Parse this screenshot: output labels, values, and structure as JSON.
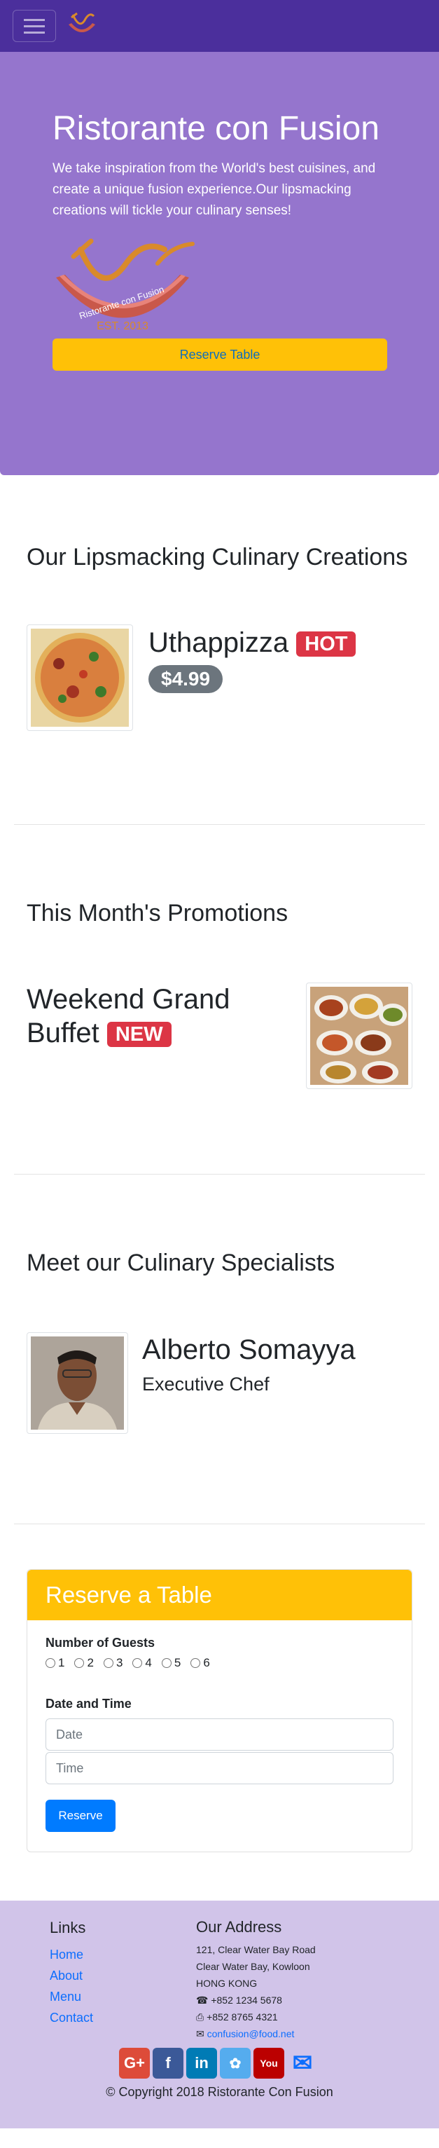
{
  "navbar": {
    "menu_icon": "hamburger-icon",
    "logo_icon": "logo-icon"
  },
  "jumbotron": {
    "title": "Ristorante con Fusion",
    "text": "We take inspiration from the World's best cuisines, and create a unique fusion experience.Our lipsmacking creations will tickle your culinary senses!",
    "logo_text": "Ristorante con Fusion",
    "logo_est": "EST. 2013",
    "reserve_button": "Reserve Table"
  },
  "dish": {
    "heading": "Our Lipsmacking Culinary Creations",
    "name": "Uthappizza",
    "badge": "HOT",
    "price": "$4.99"
  },
  "promotion": {
    "heading": "This Month's Promotions",
    "name": "Weekend Grand Buffet",
    "badge": "NEW"
  },
  "leader": {
    "heading": "Meet our Culinary Specialists",
    "name": "Alberto Somayya",
    "title": "Executive Chef"
  },
  "reserve": {
    "header": "Reserve a Table",
    "guests_label": "Number of Guests",
    "guest_options": [
      "1",
      "2",
      "3",
      "4",
      "5",
      "6"
    ],
    "datetime_label": "Date and Time",
    "date_placeholder": "Date",
    "time_placeholder": "Time",
    "submit": "Reserve"
  },
  "footer": {
    "links_heading": "Links",
    "links": [
      "Home",
      "About",
      "Menu",
      "Contact"
    ],
    "address_heading": "Our Address",
    "address": [
      "121, Clear Water Bay Road",
      "Clear Water Bay, Kowloon",
      "HONG KONG"
    ],
    "phone": "+852 1234 5678",
    "fax": "+852 8765 4321",
    "email": "confusion@food.net",
    "copyright": "© Copyright 2018 Ristorante Con Fusion",
    "colors": {
      "google": "#dd4b39",
      "facebook": "#3b5998",
      "linkedin": "#007bb5",
      "twitter": "#55acee",
      "youtube": "#bb0000"
    }
  }
}
